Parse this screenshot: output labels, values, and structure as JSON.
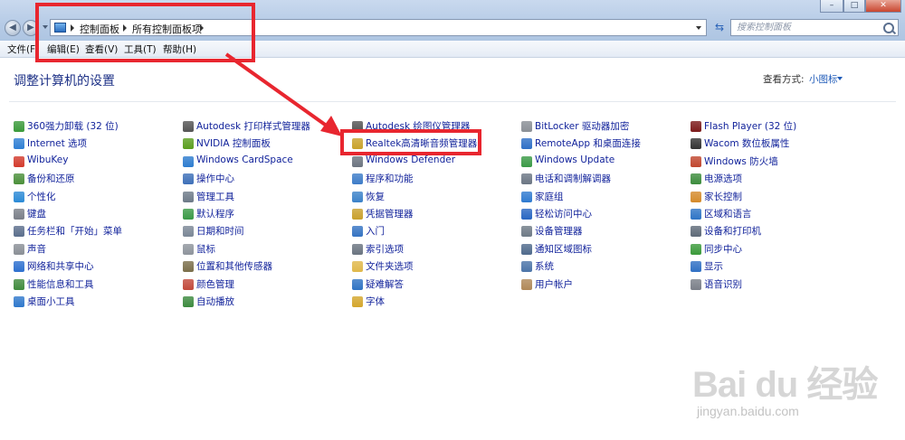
{
  "address_bar": {
    "crumbs": [
      "控制面板",
      "所有控制面板项"
    ],
    "search_placeholder": "搜索控制面板"
  },
  "menubar": [
    "文件(F)",
    "编辑(E)",
    "查看(V)",
    "工具(T)",
    "帮助(H)"
  ],
  "main": {
    "title": "调整计算机的设置",
    "view_by_label": "查看方式:",
    "view_by_value": "小图标"
  },
  "columns": [
    [
      {
        "label": "360强力卸载 (32 位)",
        "icon": "uninstall-icon",
        "color": "#3a9a3a"
      },
      {
        "label": "Internet 选项",
        "icon": "internet-options-icon",
        "color": "#2f7fd4"
      },
      {
        "label": "WibuKey",
        "icon": "wibukey-icon",
        "color": "#d33a2c"
      },
      {
        "label": "备份和还原",
        "icon": "backup-icon",
        "color": "#4a8f3a"
      },
      {
        "label": "个性化",
        "icon": "personalize-icon",
        "color": "#2b8ad6"
      },
      {
        "label": "键盘",
        "icon": "keyboard-icon",
        "color": "#7a7f88"
      },
      {
        "label": "任务栏和「开始」菜单",
        "icon": "taskbar-icon",
        "color": "#5b6e8c"
      },
      {
        "label": "声音",
        "icon": "sound-icon",
        "color": "#8a8f96"
      },
      {
        "label": "网络和共享中心",
        "icon": "network-icon",
        "color": "#2d6fcf"
      },
      {
        "label": "性能信息和工具",
        "icon": "performance-icon",
        "color": "#3f8a3c"
      },
      {
        "label": "桌面小工具",
        "icon": "gadgets-icon",
        "color": "#2f78cc"
      }
    ],
    [
      {
        "label": "Autodesk 打印样式管理器",
        "icon": "autodesk-plot-icon",
        "color": "#555555"
      },
      {
        "label": "NVIDIA 控制面板",
        "icon": "nvidia-icon",
        "color": "#5a9e1e"
      },
      {
        "label": "Windows CardSpace",
        "icon": "cardspace-icon",
        "color": "#2d7ccf"
      },
      {
        "label": "操作中心",
        "icon": "action-center-icon",
        "color": "#3d6fb8"
      },
      {
        "label": "管理工具",
        "icon": "admin-tools-icon",
        "color": "#6d7a88"
      },
      {
        "label": "默认程序",
        "icon": "default-programs-icon",
        "color": "#3a9a46"
      },
      {
        "label": "日期和时间",
        "icon": "clock-icon",
        "color": "#7b8796"
      },
      {
        "label": "鼠标",
        "icon": "mouse-icon",
        "color": "#8e949c"
      },
      {
        "label": "位置和其他传感器",
        "icon": "sensor-icon",
        "color": "#7a6e4a"
      },
      {
        "label": "颜色管理",
        "icon": "color-management-icon",
        "color": "#c2483a"
      },
      {
        "label": "自动播放",
        "icon": "autoplay-icon",
        "color": "#3c8a3e"
      }
    ],
    [
      {
        "label": "Autodesk 绘图仪管理器",
        "icon": "autodesk-plotter-icon",
        "color": "#555555"
      },
      {
        "label": "Realtek高清晰音频管理器",
        "icon": "realtek-audio-icon",
        "color": "#c9a22a"
      },
      {
        "label": "Windows Defender",
        "icon": "defender-icon",
        "color": "#6c7480"
      },
      {
        "label": "程序和功能",
        "icon": "programs-icon",
        "color": "#3d7cc8"
      },
      {
        "label": "恢复",
        "icon": "recovery-icon",
        "color": "#3c82c9"
      },
      {
        "label": "凭据管理器",
        "icon": "credential-icon",
        "color": "#c9a02c"
      },
      {
        "label": "入门",
        "icon": "getting-started-icon",
        "color": "#3573c2"
      },
      {
        "label": "索引选项",
        "icon": "indexing-icon",
        "color": "#6a7480"
      },
      {
        "label": "文件夹选项",
        "icon": "folder-options-icon",
        "color": "#e0b84a"
      },
      {
        "label": "疑难解答",
        "icon": "troubleshoot-icon",
        "color": "#2f73c4"
      },
      {
        "label": "字体",
        "icon": "fonts-icon",
        "color": "#d4a62c"
      }
    ],
    [
      {
        "label": "BitLocker 驱动器加密",
        "icon": "bitlocker-icon",
        "color": "#8a8f96"
      },
      {
        "label": "RemoteApp 和桌面连接",
        "icon": "remoteapp-icon",
        "color": "#2e6fc6"
      },
      {
        "label": "Windows Update",
        "icon": "windows-update-icon",
        "color": "#3a9a46"
      },
      {
        "label": "电话和调制解调器",
        "icon": "phone-icon",
        "color": "#6b7684"
      },
      {
        "label": "家庭组",
        "icon": "homegroup-icon",
        "color": "#2f7ad0"
      },
      {
        "label": "轻松访问中心",
        "icon": "ease-of-access-icon",
        "color": "#2866c2"
      },
      {
        "label": "设备管理器",
        "icon": "device-manager-icon",
        "color": "#6e7a86"
      },
      {
        "label": "通知区域图标",
        "icon": "notification-icon",
        "color": "#4f6a8c"
      },
      {
        "label": "系统",
        "icon": "system-icon",
        "color": "#4b74a8"
      },
      {
        "label": "用户帐户",
        "icon": "user-accounts-icon",
        "color": "#b08858"
      }
    ],
    [
      {
        "label": "Flash Player (32 位)",
        "icon": "flash-icon",
        "color": "#7c1a1a"
      },
      {
        "label": "Wacom 数位板属性",
        "icon": "wacom-icon",
        "color": "#333333"
      },
      {
        "label": "Windows 防火墙",
        "icon": "firewall-icon",
        "color": "#c0462e"
      },
      {
        "label": "电源选项",
        "icon": "power-icon",
        "color": "#3c8c3c"
      },
      {
        "label": "家长控制",
        "icon": "parental-control-icon",
        "color": "#d48a2a"
      },
      {
        "label": "区域和语言",
        "icon": "region-icon",
        "color": "#2e74c6"
      },
      {
        "label": "设备和打印机",
        "icon": "printer-icon",
        "color": "#5e6a78"
      },
      {
        "label": "同步中心",
        "icon": "sync-icon",
        "color": "#3a9a3a"
      },
      {
        "label": "显示",
        "icon": "display-icon",
        "color": "#2f6fc4"
      },
      {
        "label": "语音识别",
        "icon": "microphone-icon",
        "color": "#7a7f88"
      }
    ]
  ],
  "watermark": {
    "logo": "Bai du 经验",
    "url": "jingyan.baidu.com"
  },
  "colors": {
    "link": "#12239b",
    "heading": "#1e3287",
    "annotation_red": "#e8262f"
  }
}
